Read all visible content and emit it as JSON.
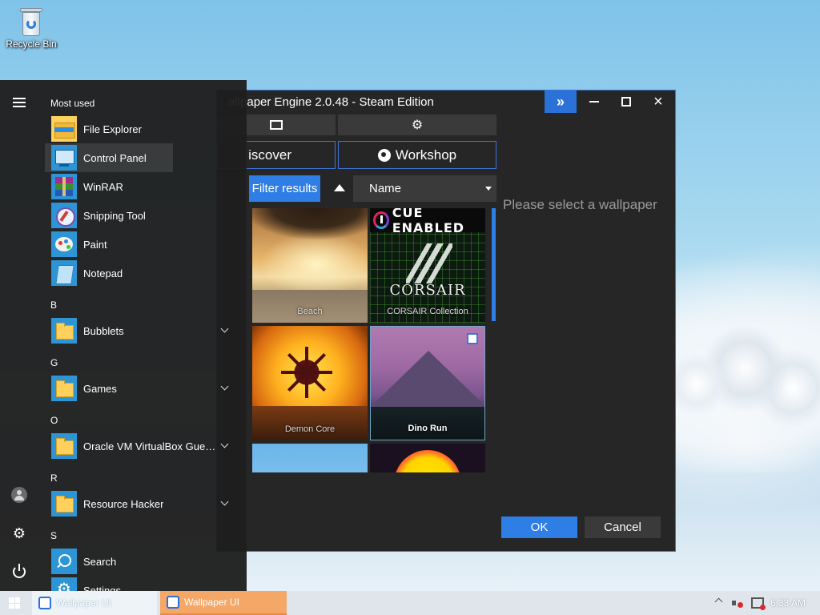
{
  "desktop": {
    "recycle_bin_label": "Recycle Bin"
  },
  "wallpaper_engine": {
    "title": "allpaper Engine 2.0.48 - Steam Edition",
    "tabs": {
      "discover": "iscover",
      "workshop": "Workshop"
    },
    "filter_label": "Filter results",
    "sort_value": "Name",
    "empty_message": "Please select a wallpaper",
    "ok_label": "OK",
    "cancel_label": "Cancel",
    "wallpapers": [
      {
        "title": "Beach"
      },
      {
        "title": "CORSAIR Collection",
        "banner": "CUE ENABLED",
        "wordmark": "CORSAIR"
      },
      {
        "title": "Demon Core"
      },
      {
        "title": "Dino Run"
      }
    ],
    "accent": "#2f7ee6"
  },
  "start_menu": {
    "most_used_header": "Most used",
    "most_used": [
      {
        "label": "File Explorer",
        "icon": "folder-explorer-icon"
      },
      {
        "label": "Control Panel",
        "icon": "control-panel-icon"
      },
      {
        "label": "WinRAR",
        "icon": "winrar-icon"
      },
      {
        "label": "Snipping Tool",
        "icon": "snipping-tool-icon"
      },
      {
        "label": "Paint",
        "icon": "paint-icon"
      },
      {
        "label": "Notepad",
        "icon": "notepad-icon"
      }
    ],
    "groups": [
      {
        "letter": "B",
        "label": "Bubblets"
      },
      {
        "letter": "G",
        "label": "Games"
      },
      {
        "letter": "O",
        "label": "Oracle VM VirtualBox Guest A..."
      },
      {
        "letter": "R",
        "label": "Resource Hacker"
      },
      {
        "letter": "S",
        "label": "Search"
      }
    ],
    "partial_item": "Settings"
  },
  "taskbar": {
    "items": [
      {
        "label": "Wallpaper UI"
      },
      {
        "label": "Wallpaper UI"
      }
    ],
    "clock": "6:33 AM"
  }
}
